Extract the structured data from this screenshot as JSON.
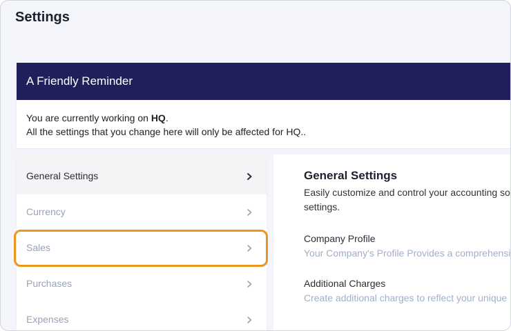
{
  "page": {
    "title": "Settings"
  },
  "reminder": {
    "title": "A Friendly Reminder",
    "line1_prefix": "You are currently working on ",
    "line1_branch": "HQ",
    "line1_suffix": ".",
    "line2": "All the settings that you change here will only be affected for HQ.."
  },
  "sidebar": {
    "items": [
      {
        "label": "General Settings",
        "active": true
      },
      {
        "label": "Currency"
      },
      {
        "label": "Sales"
      },
      {
        "label": "Purchases"
      },
      {
        "label": "Expenses"
      }
    ],
    "highlight_color": "#e8961e"
  },
  "content": {
    "title": "General Settings",
    "description": "Easily customize and control your accounting so settings.",
    "items": [
      {
        "title": "Company Profile",
        "description": "Your Company's Profile Provides a comprehensiv"
      },
      {
        "title": "Additional Charges",
        "description": "Create additional charges to reflect your unique b"
      }
    ]
  },
  "colors": {
    "header_navy": "#1f1f5b",
    "muted_text": "#98a2b8",
    "link_desc": "#9fb0cc"
  }
}
